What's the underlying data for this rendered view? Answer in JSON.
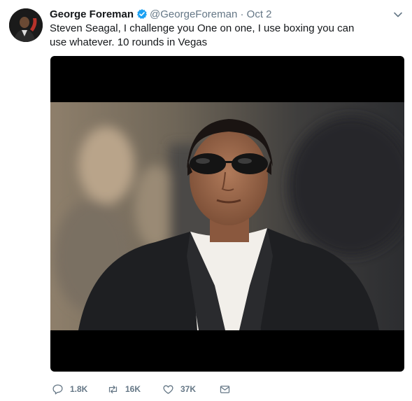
{
  "tweet": {
    "author_name": "George Foreman",
    "handle": "@GeorgeForeman",
    "separator": "·",
    "date": "Oct 2",
    "text": "Steven Seagal, I challenge you One on one, I use boxing you can use whatever. 10 rounds in Vegas",
    "avatar_icon": "person-avatar",
    "verified_icon": "verified-badge-icon",
    "media_icon": "photo-man-sunglasses-suit"
  },
  "actions": {
    "reply_count": "1.8K",
    "retweet_count": "16K",
    "like_count": "37K"
  },
  "colors": {
    "text": "#14171a",
    "secondary": "#657786",
    "verified": "#1da1f2"
  }
}
